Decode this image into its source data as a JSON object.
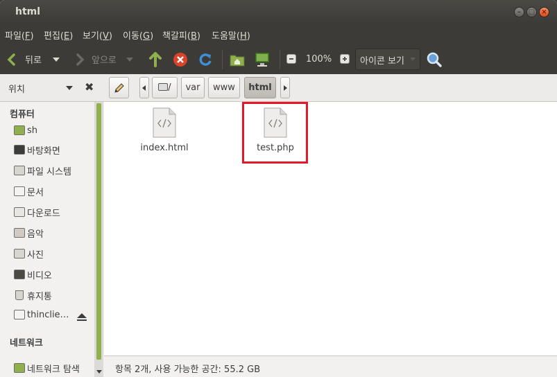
{
  "window": {
    "title": "html"
  },
  "menubar": {
    "items": [
      {
        "label": "파일(",
        "key": "F",
        "end": ")"
      },
      {
        "label": "편집(",
        "key": "E",
        "end": ")"
      },
      {
        "label": "보기(",
        "key": "V",
        "end": ")"
      },
      {
        "label": "이동(",
        "key": "G",
        "end": ")"
      },
      {
        "label": "책갈피(",
        "key": "B",
        "end": ")"
      },
      {
        "label": "도움말(",
        "key": "H",
        "end": ")"
      }
    ]
  },
  "toolbar": {
    "back_label": "뒤로",
    "forward_label": "앞으로",
    "zoom": "100%",
    "view_mode": "아이콘 보기"
  },
  "location": {
    "label": "위치",
    "path": [
      "/",
      "var",
      "www",
      "html"
    ],
    "active": "html"
  },
  "sidebar": {
    "computer_header": "컴퓨터",
    "computer_items": [
      {
        "label": "sh",
        "icon": "home-folder-icon"
      },
      {
        "label": "바탕화면",
        "icon": "desktop-icon"
      },
      {
        "label": "파일 시스템",
        "icon": "drive-icon"
      },
      {
        "label": "문서",
        "icon": "documents-folder-icon"
      },
      {
        "label": "다운로드",
        "icon": "downloads-folder-icon"
      },
      {
        "label": "음악",
        "icon": "music-folder-icon"
      },
      {
        "label": "사진",
        "icon": "pictures-folder-icon"
      },
      {
        "label": "비디오",
        "icon": "videos-folder-icon"
      },
      {
        "label": "휴지통",
        "icon": "trash-icon"
      },
      {
        "label": "thinclie…",
        "icon": "drive-icon"
      }
    ],
    "network_header": "네트워크",
    "network_items": [
      {
        "label": "네트워크 탐색",
        "icon": "network-icon"
      }
    ]
  },
  "files": [
    {
      "name": "index.html",
      "icon": "html-file-icon"
    },
    {
      "name": "test.php",
      "icon": "php-file-icon"
    }
  ],
  "status": {
    "text": "항목 2개, 사용 가능한 공간: 55.2 GB"
  },
  "colors": {
    "highlight": "#e4182b",
    "accent": "#8fb04d",
    "chrome": "#3c3b37"
  }
}
